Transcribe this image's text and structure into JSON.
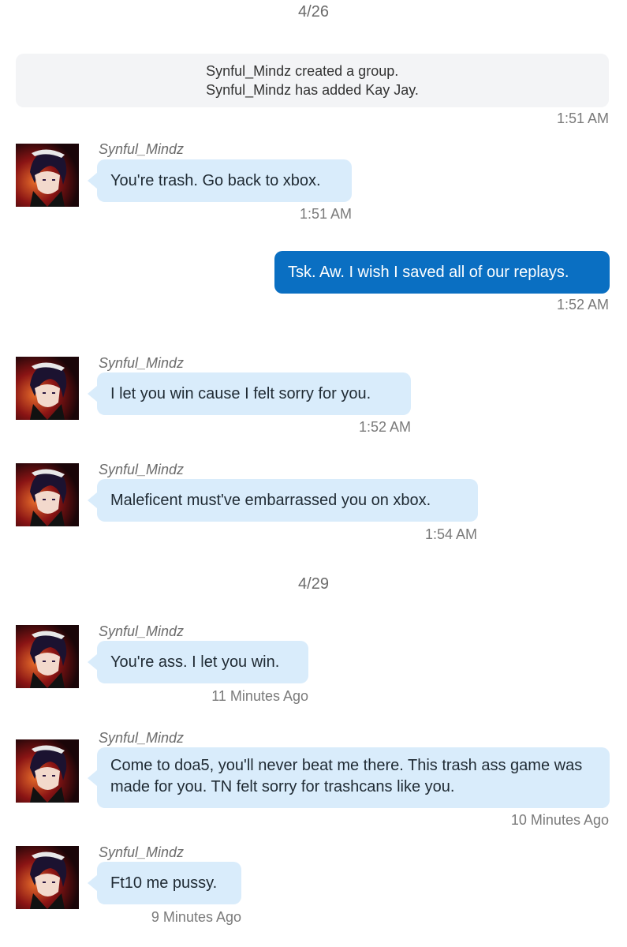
{
  "dates": {
    "first": "4/26",
    "second": "4/29"
  },
  "system": {
    "line1": "Synful_Mindz created a group.",
    "line2": "Synful_Mindz has added Kay Jay.",
    "time": "1:51 AM"
  },
  "messages": [
    {
      "sender": "Synful_Mindz",
      "text": "You're trash. Go back to xbox.",
      "time": "1:51 AM",
      "direction": "incoming"
    },
    {
      "sender": "",
      "text": "Tsk. Aw. I wish I saved all of our replays.",
      "time": "1:52 AM",
      "direction": "outgoing"
    },
    {
      "sender": "Synful_Mindz",
      "text": "I let you win cause I felt sorry for you.",
      "time": "1:52 AM",
      "direction": "incoming"
    },
    {
      "sender": "Synful_Mindz",
      "text": "Maleficent must've embarrassed you on xbox.",
      "time": "1:54 AM",
      "direction": "incoming"
    },
    {
      "sender": "Synful_Mindz",
      "text": "You're ass. I let you win.",
      "time": "11 Minutes Ago",
      "direction": "incoming"
    },
    {
      "sender": "Synful_Mindz",
      "text": "Come to doa5, you'll never beat me there. This trash ass game was made for you. TN felt sorry for trashcans like you.",
      "time": "10 Minutes Ago",
      "direction": "incoming"
    },
    {
      "sender": "Synful_Mindz",
      "text": "Ft10 me pussy.",
      "time": "9 Minutes Ago",
      "direction": "incoming"
    }
  ],
  "colors": {
    "incoming_bubble": "#d9ecfb",
    "outgoing_bubble": "#0a6fc2",
    "system_box": "#f3f4f6"
  },
  "icons": {
    "avatar": "user-avatar-image"
  }
}
